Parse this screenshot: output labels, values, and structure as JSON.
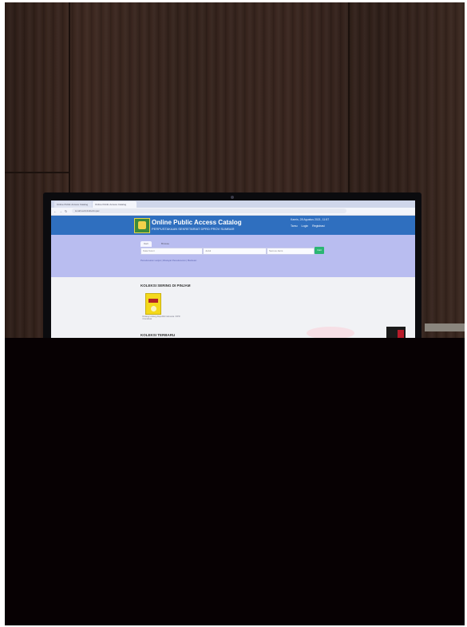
{
  "browser": {
    "tabs": [
      "Online Public Access Catalog",
      "Online Public Access Catalog"
    ],
    "url": "localhost/inlislite3/opac"
  },
  "header": {
    "title": "Online Public Access Catalog",
    "subtitle": "PERPUSTAKAAN SEKRETARIAT DPRD PROV SUMBAR",
    "date": "Kamis, 28 Agustus 2021, 11:57",
    "links": [
      "Tamu",
      "Login",
      "Registrasi"
    ]
  },
  "search": {
    "tabs": [
      "Cari",
      "Browse"
    ],
    "keyword_placeholder": "Kata Kunci",
    "field_value": "Judul",
    "type_value": "Semua Jenis",
    "button": "Cari",
    "advanced_link": "Penelusuran Lanjut | Riwayat Penelusuran | Bantuan"
  },
  "main": {
    "popular_title": "KOLEKSI SERING DI PINJAM",
    "popular_book_caption": "Undang Undang Republik Indonesia / DPR / Konstitusi",
    "new_title": "KOLEKSI TERBARU"
  },
  "colors": {
    "header_blue": "#2f6fbf",
    "search_band": "#b9bdf0",
    "search_button": "#2bb673",
    "wall": "#3a261f",
    "foreground": "#070103"
  }
}
